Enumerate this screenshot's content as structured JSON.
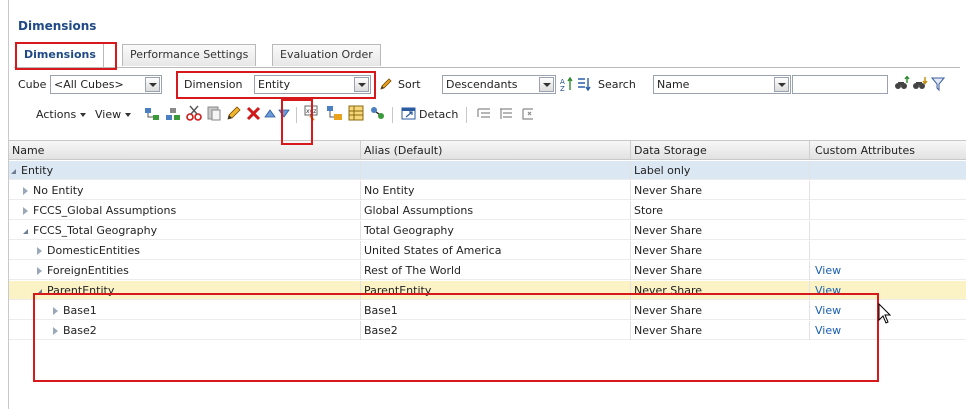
{
  "panel": {
    "title": "Dimensions"
  },
  "tabs": [
    {
      "label": "Dimensions"
    },
    {
      "label": "Performance Settings"
    },
    {
      "label": "Evaluation Order"
    }
  ],
  "toolbar1": {
    "cube_label": "Cube",
    "cube_value": "<All Cubes>",
    "dimension_label": "Dimension",
    "dimension_value": "Entity",
    "sort_label": "Sort",
    "sort_value": "Descendants",
    "search_label": "Search",
    "search_value": "Name",
    "search_text": ""
  },
  "toolbar2": {
    "actions_label": "Actions",
    "view_label": "View",
    "detach_label": "Detach"
  },
  "table": {
    "columns": [
      "Name",
      "Alias (Default)",
      "Data Storage",
      "Custom Attributes"
    ],
    "rows": [
      {
        "name": "Entity",
        "alias": "",
        "storage": "Label only",
        "custom": "",
        "level": 0,
        "expanded": true
      },
      {
        "name": "No Entity",
        "alias": "No Entity",
        "storage": "Never Share",
        "custom": "",
        "level": 1,
        "expanded": false
      },
      {
        "name": "FCCS_Global Assumptions",
        "alias": "Global Assumptions",
        "storage": "Store",
        "custom": "",
        "level": 1,
        "expanded": false
      },
      {
        "name": "FCCS_Total Geography",
        "alias": "Total Geography",
        "storage": "Never Share",
        "custom": "",
        "level": 1,
        "expanded": true
      },
      {
        "name": "DomesticEntities",
        "alias": "United States of America",
        "storage": "Never Share",
        "custom": "",
        "level": 2,
        "expanded": false
      },
      {
        "name": "ForeignEntities",
        "alias": "Rest of The World",
        "storage": "Never Share",
        "custom": "View",
        "level": 2,
        "expanded": false
      },
      {
        "name": "ParentEntity",
        "alias": "ParentEntity",
        "storage": "Never Share",
        "custom": "View",
        "level": 2,
        "expanded": true
      },
      {
        "name": "Base1",
        "alias": "Base1",
        "storage": "Never Share",
        "custom": "View",
        "level": 3,
        "expanded": false
      },
      {
        "name": "Base2",
        "alias": "Base2",
        "storage": "Never Share",
        "custom": "View",
        "level": 3,
        "expanded": false
      }
    ]
  },
  "colors": {
    "title": "#1f4a86",
    "group_row": "#dbe7f3",
    "selected_row": "#fbf3c5",
    "link": "#1a5fb4",
    "highlight_box": "#d7191c"
  }
}
